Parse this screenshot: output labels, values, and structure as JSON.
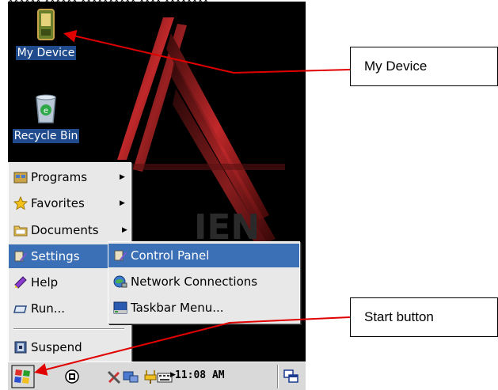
{
  "desktop": {
    "icons": [
      {
        "label": "My Device",
        "icon": "my-device-icon"
      },
      {
        "label": "Recycle Bin",
        "icon": "recycle-bin-icon"
      }
    ],
    "background_logo": "alien-logo"
  },
  "start_menu": {
    "items": [
      {
        "label": "Programs",
        "icon": "programs-icon"
      },
      {
        "label": "Favorites",
        "icon": "favorites-icon"
      },
      {
        "label": "Documents",
        "icon": "documents-icon"
      },
      {
        "label": "Settings",
        "icon": "settings-icon",
        "selected": true
      },
      {
        "label": "Help",
        "icon": "help-icon"
      },
      {
        "label": "Run...",
        "icon": "run-icon"
      },
      {
        "label": "Suspend",
        "icon": "suspend-icon"
      }
    ]
  },
  "settings_submenu": {
    "items": [
      {
        "label": "Control Panel",
        "icon": "control-panel-icon",
        "selected": true
      },
      {
        "label": "Network Connections",
        "icon": "network-icon"
      },
      {
        "label": "Taskbar Menu...",
        "icon": "taskbar-menu-icon"
      }
    ]
  },
  "taskbar": {
    "time": "11:08 AM",
    "tray_icons": [
      "input-panel-icon",
      "tools-icon",
      "connectivity-icon",
      "power-icon",
      "keyboard-icon",
      "expand-arrow-icon",
      "desktop-toggle-icon"
    ]
  },
  "callouts": {
    "my_device": "My Device",
    "start_button": "Start button"
  },
  "colors": {
    "selection": "#3b6fb6",
    "callout_line": "#e00000",
    "menu_bg": "#e8e8e8"
  }
}
